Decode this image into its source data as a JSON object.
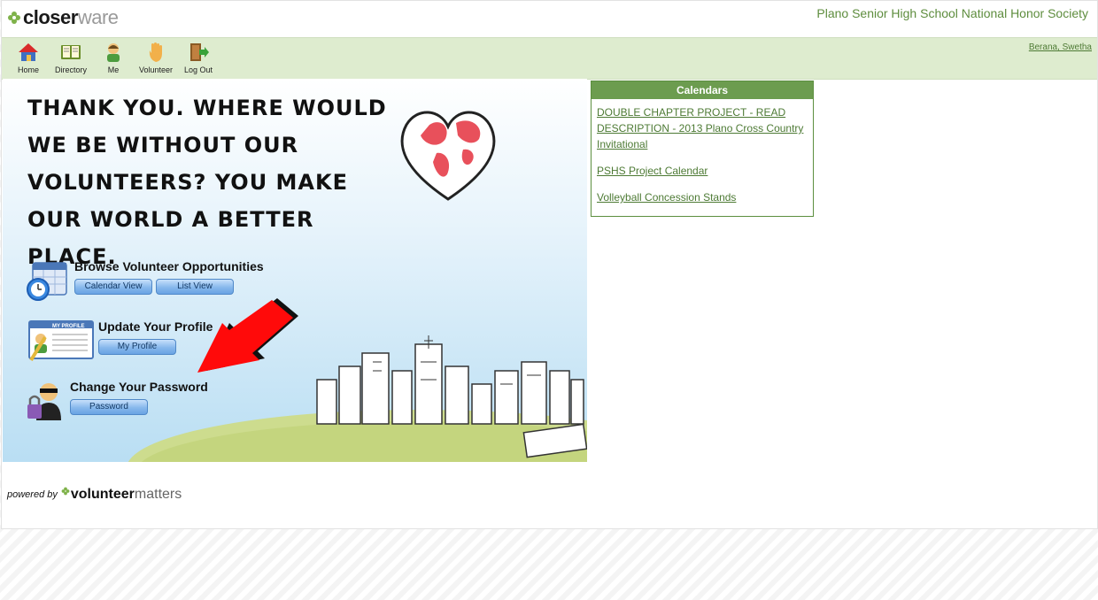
{
  "brand": {
    "strong": "closer",
    "light": "ware"
  },
  "org_name": "Plano Senior High School National Honor Society",
  "nav": {
    "items": [
      {
        "label": "Home",
        "icon": "home-icon"
      },
      {
        "label": "Directory",
        "icon": "book-icon"
      },
      {
        "label": "Me",
        "icon": "person-icon"
      },
      {
        "label": "Volunteer",
        "icon": "hand-icon"
      },
      {
        "label": "Log Out",
        "icon": "door-exit-icon"
      }
    ],
    "user": "Berana, Swetha"
  },
  "banner": {
    "tagline": "THANK YOU.  WHERE WOULD WE BE WITHOUT OUR VOLUNTEERS? YOU MAKE OUR WORLD A BETTER PLACE.",
    "browse": {
      "title": "Browse Volunteer Opportunities",
      "calendar_btn": "Calendar View",
      "list_btn": "List View"
    },
    "profile": {
      "title": "Update Your Profile",
      "btn": "My Profile",
      "card_label": "MY PROFILE"
    },
    "password": {
      "title": "Change Your Password",
      "btn": "Password"
    }
  },
  "calendars": {
    "title": "Calendars",
    "items": [
      "DOUBLE CHAPTER PROJECT - READ DESCRIPTION - 2013 Plano Cross Country Invitational",
      "PSHS Project Calendar",
      "Volleyball Concession Stands"
    ]
  },
  "footer": {
    "powered_by": "powered by",
    "brand_strong": "volunteer",
    "brand_light": "matters"
  },
  "colors": {
    "accent_green": "#6c9c4f",
    "nav_bg": "#deeccf",
    "link_green": "#4d7a34",
    "button_blue": "#6aa3e3"
  }
}
